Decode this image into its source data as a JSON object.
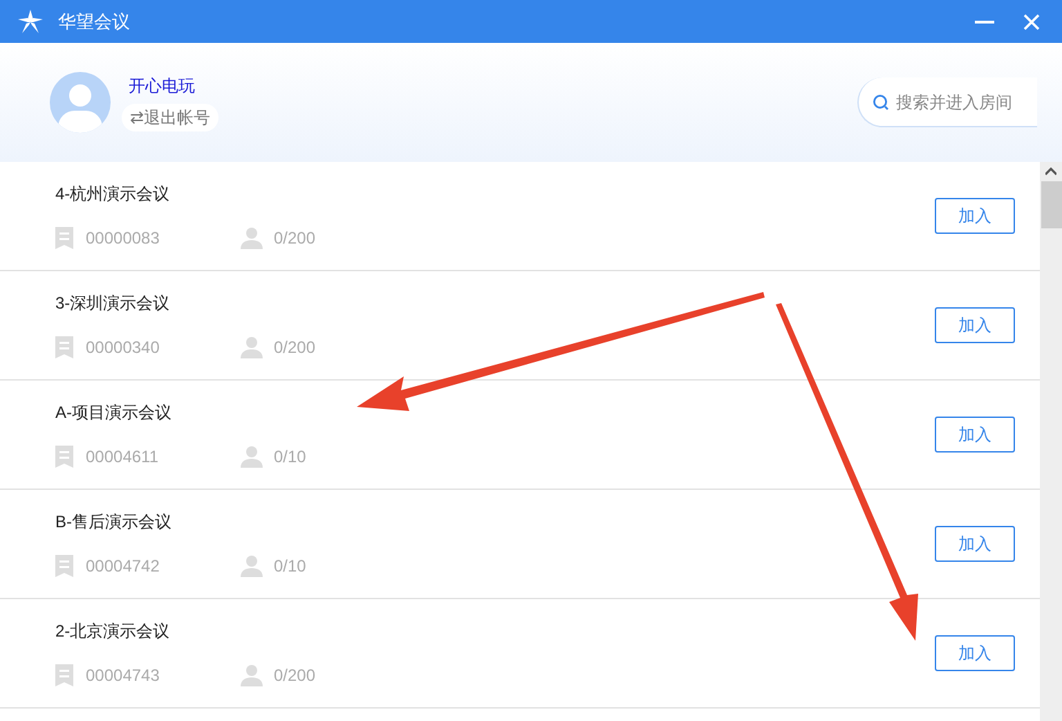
{
  "window": {
    "title": "华望会议"
  },
  "user": {
    "name": "开心电玩",
    "logout": "⇄退出帐号"
  },
  "search": {
    "placeholder": "搜索并进入房间"
  },
  "rooms": [
    {
      "name": "4-杭州演示会议",
      "id": "00000083",
      "members": "0/200",
      "button": "加入"
    },
    {
      "name": "3-深圳演示会议",
      "id": "00000340",
      "members": "0/200",
      "button": "加入"
    },
    {
      "name": "A-项目演示会议",
      "id": "00004611",
      "members": "0/10",
      "button": "加入"
    },
    {
      "name": "B-售后演示会议",
      "id": "00004742",
      "members": "0/10",
      "button": "加入"
    },
    {
      "name": "2-北京演示会议",
      "id": "00004743",
      "members": "0/200",
      "button": "加入"
    }
  ]
}
